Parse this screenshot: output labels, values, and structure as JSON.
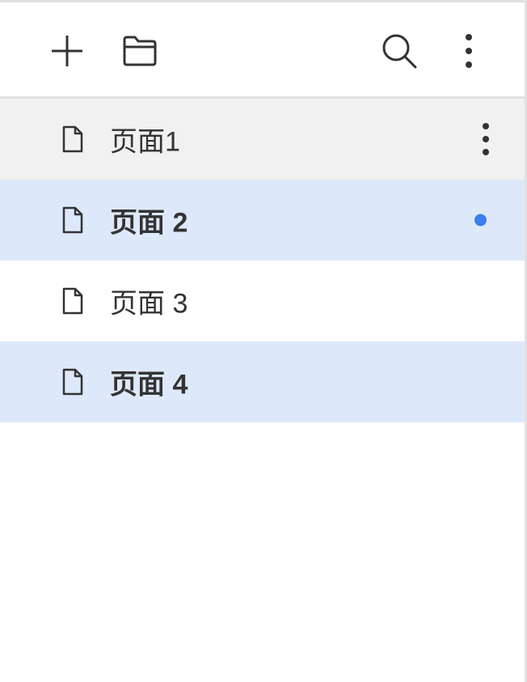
{
  "toolbar": {
    "icons": [
      "plus-icon",
      "folder-icon",
      "search-icon",
      "more-vertical-icon"
    ]
  },
  "pages": [
    {
      "label": "页面1",
      "state": "hover",
      "indicator": "more-options"
    },
    {
      "label": "页面 2",
      "state": "selected",
      "indicator": "status-dot"
    },
    {
      "label": "页面 3",
      "state": "normal",
      "indicator": ""
    },
    {
      "label": "页面 4",
      "state": "selected",
      "indicator": ""
    }
  ],
  "colors": {
    "hover_bg": "#f1f1f1",
    "selected_bg": "#dde9fa",
    "dot": "#3b7ef0",
    "border": "#e1e1e1",
    "text": "#333333",
    "icon": "#333333"
  }
}
